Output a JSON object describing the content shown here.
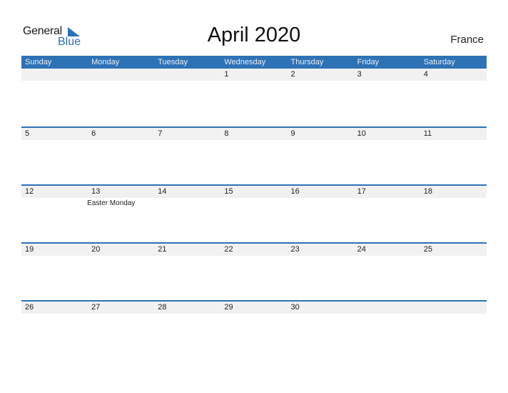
{
  "logo": {
    "line1": "General",
    "line2": "Blue"
  },
  "title": "April 2020",
  "country": "France",
  "colors": {
    "accent": "#2e72b6",
    "band": "#f1f1f1"
  },
  "weekdays": [
    "Sunday",
    "Monday",
    "Tuesday",
    "Wednesday",
    "Thursday",
    "Friday",
    "Saturday"
  ],
  "weeks": [
    {
      "days": [
        "",
        "",
        "",
        "1",
        "2",
        "3",
        "4"
      ],
      "events": [
        "",
        "",
        "",
        "",
        "",
        "",
        ""
      ]
    },
    {
      "days": [
        "5",
        "6",
        "7",
        "8",
        "9",
        "10",
        "11"
      ],
      "events": [
        "",
        "",
        "",
        "",
        "",
        "",
        ""
      ]
    },
    {
      "days": [
        "12",
        "13",
        "14",
        "15",
        "16",
        "17",
        "18"
      ],
      "events": [
        "",
        "Easter Monday",
        "",
        "",
        "",
        "",
        ""
      ]
    },
    {
      "days": [
        "19",
        "20",
        "21",
        "22",
        "23",
        "24",
        "25"
      ],
      "events": [
        "",
        "",
        "",
        "",
        "",
        "",
        ""
      ]
    },
    {
      "days": [
        "26",
        "27",
        "28",
        "29",
        "30",
        "",
        ""
      ],
      "events": [
        "",
        "",
        "",
        "",
        "",
        "",
        ""
      ]
    }
  ]
}
